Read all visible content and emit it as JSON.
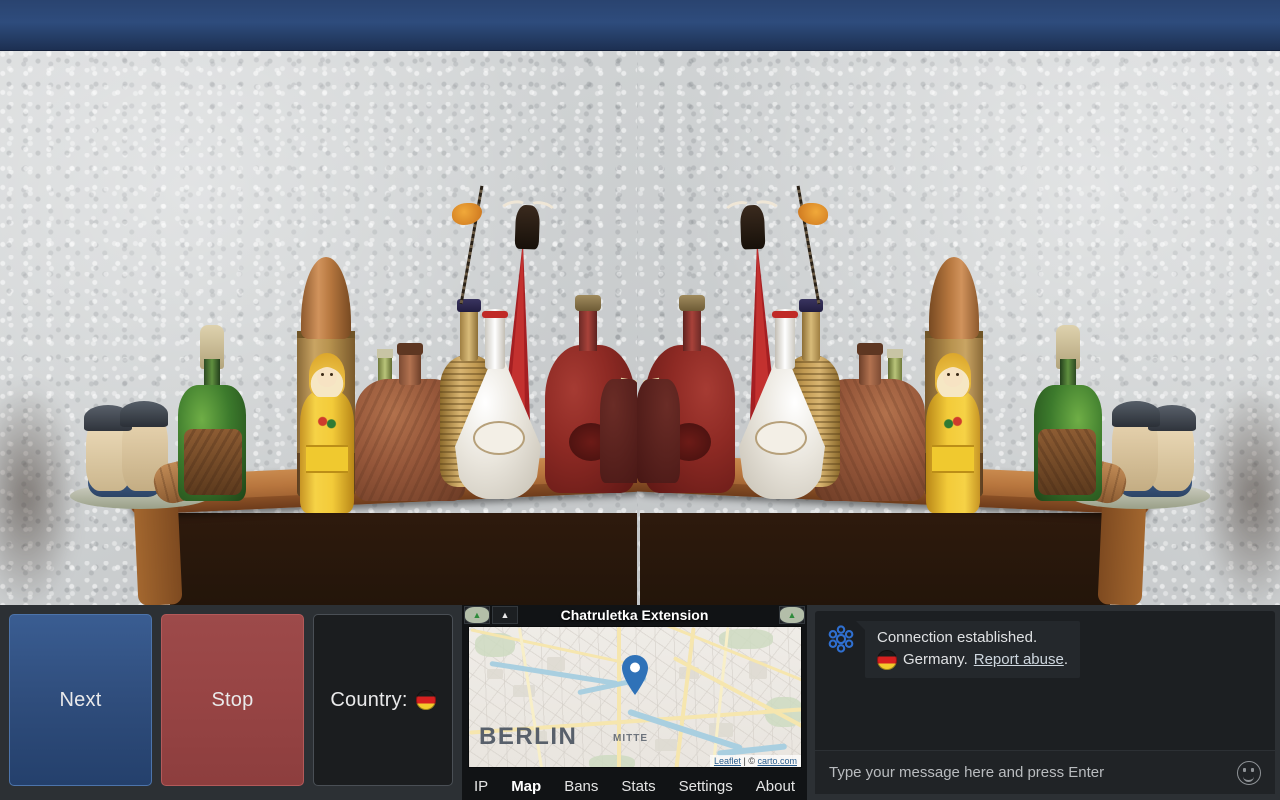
{
  "app": {
    "title": "Chatruletka Extension"
  },
  "controls": {
    "next_label": "Next",
    "stop_label": "Stop",
    "country_label": "Country:",
    "country_flag_icon": "flag-germany-icon"
  },
  "extension": {
    "title": "Chatruletka Extension",
    "titlebar_buttons_left": [
      {
        "name": "collapse-red-chevron",
        "glyph": "▲",
        "color": "#c0392b"
      },
      {
        "name": "collapse-green-chevron",
        "glyph": "▲",
        "color": "#2e8b3c"
      },
      {
        "name": "collapse-white-chevron",
        "glyph": "▲",
        "color": "#e8e8e8"
      }
    ],
    "titlebar_buttons_right": [
      {
        "name": "expand-green-chevron",
        "glyph": "▲",
        "color": "#2e8b3c"
      },
      {
        "name": "expand-red-chevron",
        "glyph": "▲",
        "color": "#c0392b"
      }
    ],
    "map": {
      "city_label": "BERLIN",
      "district_label": "MITTE",
      "marker_icon": "map-pin-icon",
      "attribution_prefix": "Leaflet",
      "attribution_separator": " | ",
      "attribution_copyright": "© ",
      "attribution_provider": "carto.com"
    },
    "tabs": [
      {
        "label": "IP",
        "active": false
      },
      {
        "label": "Map",
        "active": true
      },
      {
        "label": "Bans",
        "active": false
      },
      {
        "label": "Stats",
        "active": false
      },
      {
        "label": "Settings",
        "active": false
      },
      {
        "label": "About",
        "active": false
      }
    ]
  },
  "chat": {
    "system_icon": "chatruletka-logo-icon",
    "messages": [
      {
        "line1": "Connection established.",
        "flag_icon": "flag-germany-icon",
        "country": "Germany.",
        "link_label": "Report abuse",
        "trailing": "."
      }
    ],
    "input_placeholder": "Type your message here and press Enter",
    "emoji_icon": "smiley-icon"
  },
  "video": {
    "local_stream": "webcam-local-video",
    "remote_stream": "webcam-remote-video"
  },
  "colors": {
    "accent_blue": "#2f4d7c",
    "stop_red": "#974444",
    "header_blue": "#2e4c7d",
    "panel_dark": "#1c1f22",
    "deck_bg": "#2c3034"
  }
}
